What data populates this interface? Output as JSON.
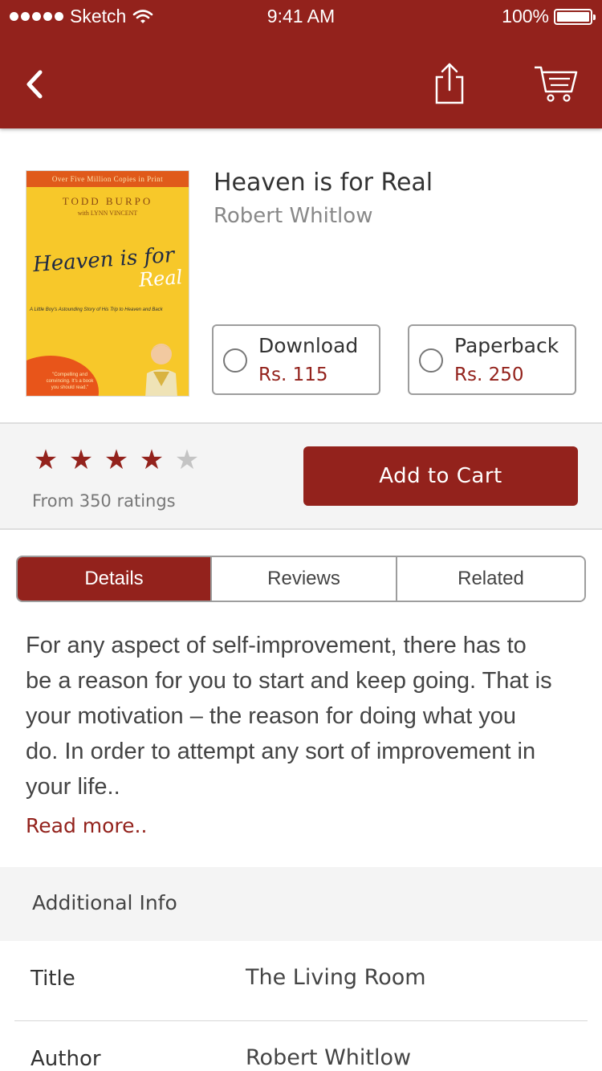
{
  "status_bar": {
    "carrier": "Sketch",
    "time": "9:41 AM",
    "battery": "100%"
  },
  "nav": {
    "back_icon": "chevron-left-icon",
    "share_icon": "share-icon",
    "cart_icon": "cart-icon"
  },
  "product": {
    "title": "Heaven is for Real",
    "author": "Robert Whitlow",
    "cover": {
      "banner": "Over Five Million Copies in Print",
      "author_line1": "TODD BURPO",
      "author_line2": "with LYNN VINCENT",
      "title_part1": "Heaven is for",
      "title_part2": "Real",
      "tagline": "A Little Boy's Astounding Story of His Trip to Heaven and Back",
      "quote": "\"Compelling and convincing. It's a book you should read.\""
    },
    "options": [
      {
        "label": "Download",
        "price": "Rs. 115"
      },
      {
        "label": "Paperback",
        "price": "Rs. 250"
      }
    ]
  },
  "rating": {
    "stars_filled": 4,
    "stars_total": 5,
    "text": "From 350 ratings"
  },
  "add_to_cart_label": "Add to Cart",
  "tabs": [
    {
      "label": "Details",
      "active": true
    },
    {
      "label": "Reviews",
      "active": false
    },
    {
      "label": "Related",
      "active": false
    }
  ],
  "description": {
    "lines": [
      "For any aspect of self-improvement, there has to",
      "be a reason for you to start and keep going. That is",
      "your motivation – the reason for doing what you",
      "do. In order to attempt any sort of improvement in",
      "your life.."
    ],
    "read_more": "Read more.."
  },
  "additional_info": {
    "heading": "Additional Info",
    "rows": [
      {
        "key": "Title",
        "value": "The Living Room"
      },
      {
        "key": "Author",
        "value": "Robert Whitlow"
      }
    ]
  },
  "colors": {
    "accent": "#93221c",
    "band": "#f4f4f4"
  }
}
